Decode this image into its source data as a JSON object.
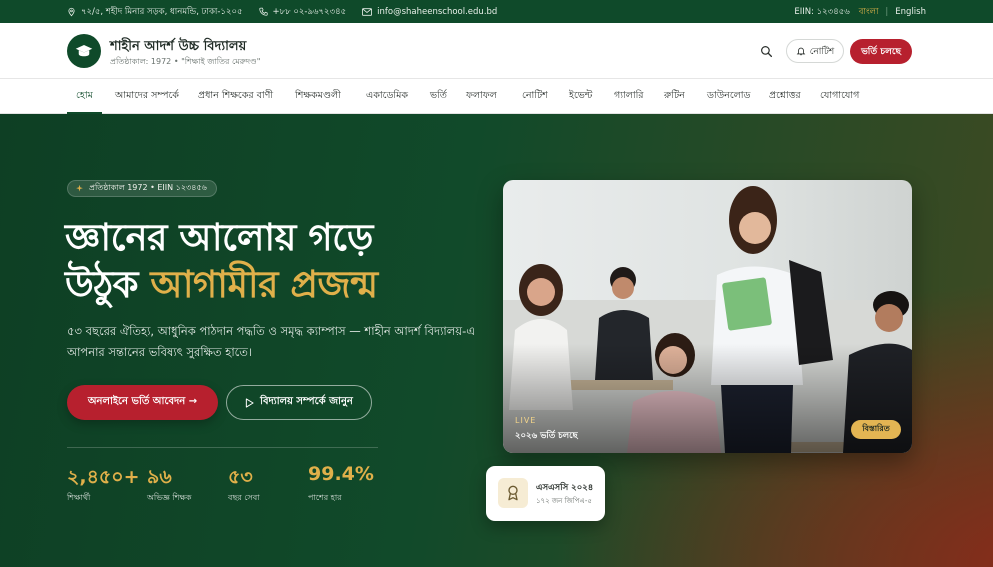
{
  "topbar": {
    "address": "৭২/৫, শহীদ মিনার সড়ক, ধানমন্ডি, ঢাকা-১২০৫",
    "phone": "+৮৮ ০২-৯৬৭২৩৪৫",
    "email": "info@shaheenschool.edu.bd",
    "eiin": "EIIN: ১২৩৪৫৬",
    "lang_bangla": "বাংলা",
    "lang_sep": "|",
    "lang_english": "English"
  },
  "header": {
    "school_name": "শাহীন আদর্শ উচ্চ বিদ্যালয়",
    "school_sub": "প্রতিষ্ঠাকাল: 1972 • \"শিক্ষাই জাতির মেরুদণ্ড\"",
    "notice_label": "নোটিশ",
    "admit_label": "ভর্তি চলছে"
  },
  "nav": {
    "items": [
      {
        "label": "হোম",
        "active": true
      },
      {
        "label": "আমাদের সম্পর্কে"
      },
      {
        "label": "প্রধান শিক্ষকের বাণী"
      },
      {
        "label": "শিক্ষকমণ্ডলী"
      },
      {
        "label": "একাডেমিক"
      },
      {
        "label": "ভর্তি"
      },
      {
        "label": "ফলাফল"
      },
      {
        "label": "নোটিশ"
      },
      {
        "label": "ইভেন্ট"
      },
      {
        "label": "গ্যালারি"
      },
      {
        "label": "রুটিন"
      },
      {
        "label": "ডাউনলোড"
      },
      {
        "label": "প্রশ্নোত্তর"
      },
      {
        "label": "যোগাযোগ"
      }
    ]
  },
  "hero": {
    "badge": "প্রতিষ্ঠাকাল 1972 • EIIN ১২৩৪৫৬",
    "title_line1": "জ্ঞানের আলোয় গড়ে",
    "title_line2_plain": "উঠুক ",
    "title_line2_gold": "আগামীর প্রজন্ম",
    "description": "৫৩ বছরের ঐতিহ্য, আধুনিক পাঠদান পদ্ধতি ও সমৃদ্ধ ক্যাম্পাস — শাহীন আদর্শ বিদ্যালয়-এ আপনার সন্তানের ভবিষ্যৎ সুরক্ষিত হাতে।",
    "cta_primary": "অনলাইনে ভর্তি আবেদন →",
    "cta_secondary": "বিদ্যালয় সম্পর্কে জানুন",
    "stats": [
      {
        "value": "২,৪৫০+",
        "label": "শিক্ষার্থী"
      },
      {
        "value": "৯৬",
        "label": "অভিজ্ঞ শিক্ষক"
      },
      {
        "value": "৫৩",
        "label": "বছর সেবা"
      },
      {
        "value": "99.4%",
        "label": "পাশের হার"
      }
    ],
    "photo": {
      "live_label": "LIVE",
      "live_sub": "২০২৬ ভর্তি চলছে",
      "details_label": "বিস্তারিত"
    },
    "result_card": {
      "title": "এসএসসি ২০২৪",
      "subtitle": "১৭২ জন জিপিএ-৫"
    }
  },
  "colors": {
    "brand_green": "#0f4a2a",
    "accent_gold": "#e0b04a",
    "accent_red": "#b7202e"
  }
}
